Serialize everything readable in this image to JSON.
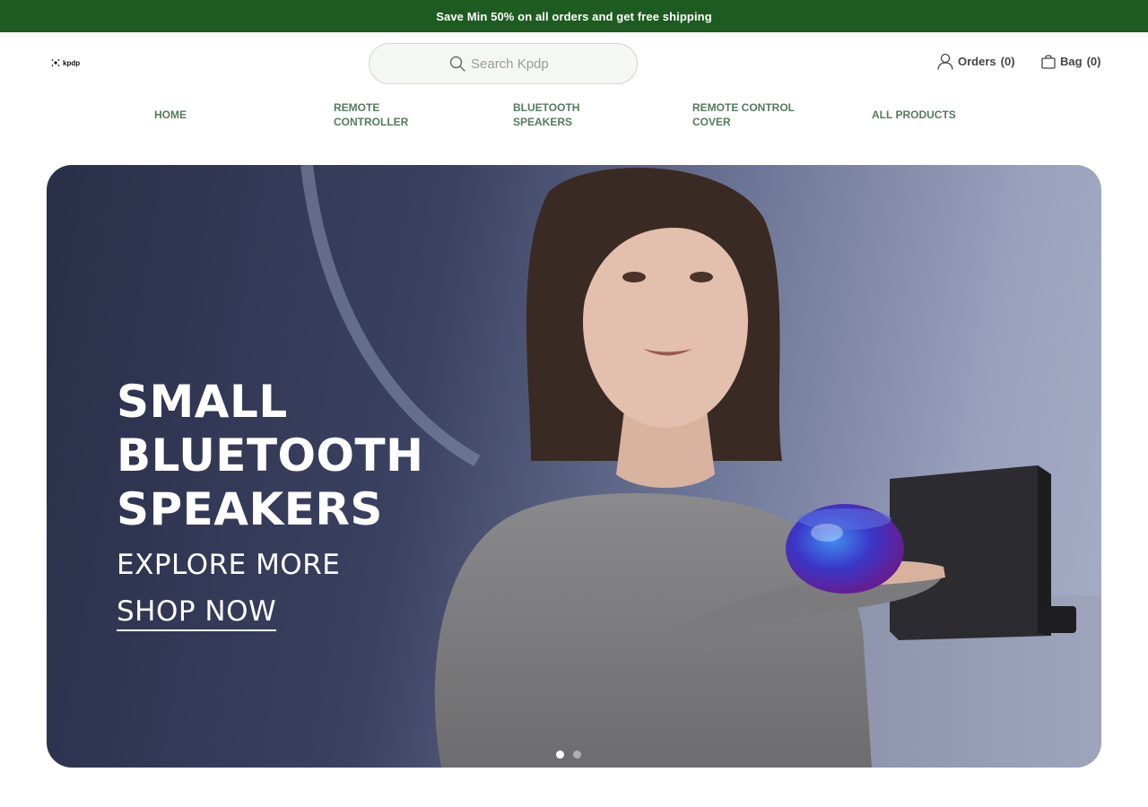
{
  "promo": {
    "text": "Save Min 50% on all orders and get free shipping"
  },
  "brand": {
    "logo_text": "kpdp"
  },
  "search": {
    "placeholder": "Search Kpdp"
  },
  "header": {
    "orders_label": "Orders",
    "orders_count": "(0)",
    "bag_label": "Bag",
    "bag_count": "(0)"
  },
  "nav": {
    "items": [
      {
        "label": "HOME"
      },
      {
        "label": "REMOTE CONTROLLER"
      },
      {
        "label": "BLUETOOTH SPEAKERS"
      },
      {
        "label": "REMOTE CONTROL COVER"
      },
      {
        "label": "ALL PRODUCTS"
      }
    ]
  },
  "hero": {
    "title": "SMALL BLUETOOTH SPEAKERS",
    "subtitle": "EXPLORE MORE",
    "cta": "SHOP NOW",
    "slide_count": 2,
    "active_slide": 1
  },
  "colors": {
    "promo_bg": "#1e5b20",
    "nav_text": "#557a5d",
    "hero_bg": "#3a4160"
  }
}
